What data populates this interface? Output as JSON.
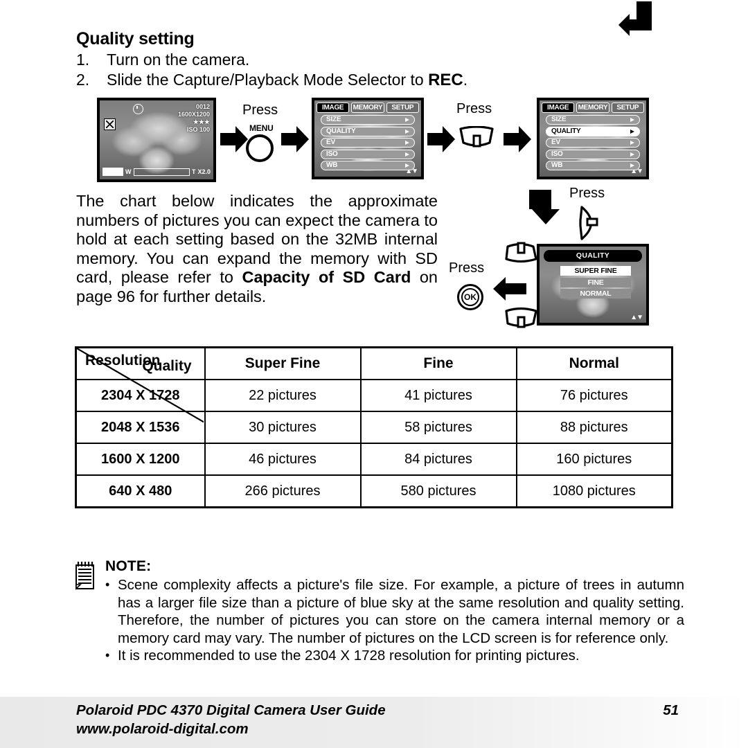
{
  "page": {
    "heading": "Quality setting",
    "steps": [
      {
        "num": "1.",
        "text": "Turn on the camera."
      },
      {
        "num": "2.",
        "text_a": "Slide the Capture/Playback Mode Selector to ",
        "text_b": "REC",
        "text_c": "."
      }
    ],
    "paragraph_a": "The chart below indicates the approximate numbers of pictures you can expect the camera to hold at each setting based on the 32MB internal memory. You can expand the memory with SD card, please refer to ",
    "paragraph_b": "Capacity of SD Card",
    "paragraph_c": " on page 96 for further details."
  },
  "diagram": {
    "press_label": "Press",
    "menu_button_label": "MENU",
    "ok_button_label": "OK",
    "camera_preview": {
      "counter": "0012",
      "resolution": "1600X1200",
      "quality_stars": "★★★",
      "iso": "ISO 100",
      "zoom_wide": "W",
      "zoom_tele": "T",
      "digital_zoom": "X2.0"
    },
    "menu_screen": {
      "tabs": [
        "IMAGE",
        "MEMORY",
        "SETUP"
      ],
      "active_tab": "IMAGE",
      "items": [
        "SIZE",
        "QUALITY",
        "EV",
        "ISO",
        "WB"
      ],
      "selected_item_first": "",
      "selected_item_second": "QUALITY",
      "scroll_caret": "▲▼"
    },
    "quality_screen": {
      "title": "QUALITY",
      "options": [
        "SUPER FINE",
        "FINE",
        "NORMAL"
      ],
      "selected": "SUPER FINE",
      "scroll_caret": "▲▼"
    }
  },
  "table": {
    "corner_top_label": "Quality",
    "corner_bottom_label": "Resolution",
    "columns": [
      "Super Fine",
      "Fine",
      "Normal"
    ],
    "rows": [
      {
        "resolution": "2304 X 1728",
        "values": [
          "22 pictures",
          "41 pictures",
          "76 pictures"
        ]
      },
      {
        "resolution": "2048 X 1536",
        "values": [
          "30 pictures",
          "58 pictures",
          "88 pictures"
        ]
      },
      {
        "resolution": "1600 X 1200",
        "values": [
          "46 pictures",
          "84 pictures",
          "160 pictures"
        ]
      },
      {
        "resolution": "640 X 480",
        "values": [
          "266 pictures",
          "580 pictures",
          "1080 pictures"
        ]
      }
    ]
  },
  "note": {
    "title": "NOTE:",
    "bullet": "•",
    "items": [
      "Scene complexity affects a picture's file size. For example, a picture of trees in autumn has a larger file size than a picture of blue sky at the same resolution and quality setting. Therefore, the number of pictures you can store on the camera internal memory or a memory card may vary. The number of pictures on the LCD screen is for reference only.",
      "It is recommended to use the 2304 X 1728 resolution for printing pictures."
    ]
  },
  "footer": {
    "title": "Polaroid PDC 4370 Digital Camera User Guide",
    "url": "www.polaroid-digital.com",
    "page_number": "51"
  }
}
